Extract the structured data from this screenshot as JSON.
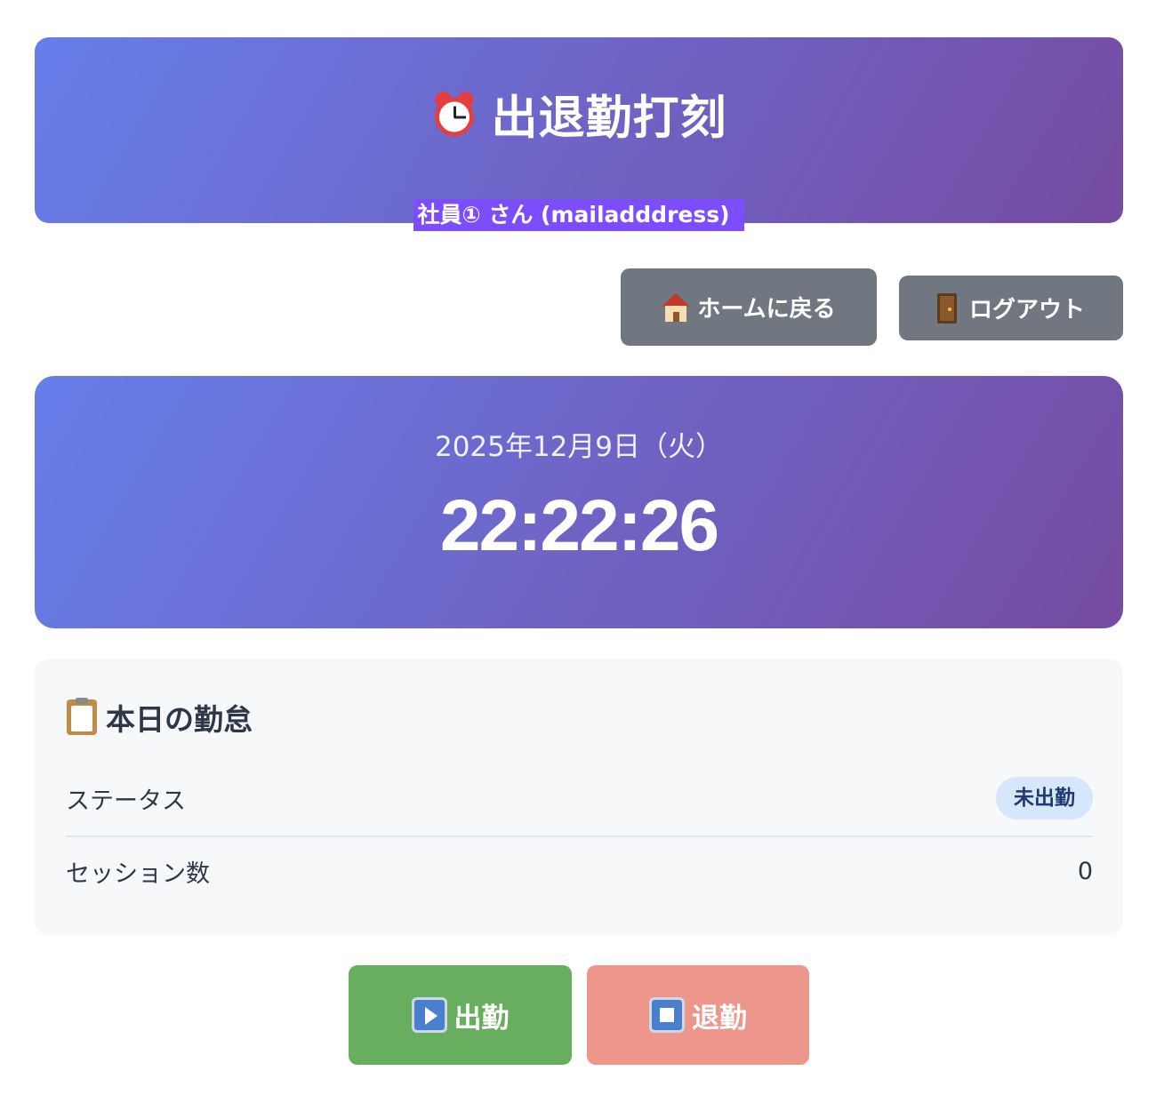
{
  "header": {
    "title": "出退勤打刻",
    "title_icon": "alarm-clock-icon",
    "user": "社員① さん (mailadddress)"
  },
  "nav": {
    "home_label": "ホームに戻る",
    "home_icon": "house-icon",
    "logout_label": "ログアウト",
    "logout_icon": "door-icon"
  },
  "clock": {
    "date": "2025年12月9日（火）",
    "time": "22:22:26"
  },
  "summary": {
    "title": "本日の勤怠",
    "title_icon": "clipboard-icon",
    "status_label": "ステータス",
    "status_value": "未出勤",
    "sessions_label": "セッション数",
    "sessions_value": "0"
  },
  "actions": {
    "clock_in_label": "出勤",
    "clock_in_icon": "play-icon",
    "clock_out_label": "退勤",
    "clock_out_icon": "stop-icon"
  },
  "colors": {
    "gradient_start": "#667eea",
    "gradient_end": "#764ba2",
    "clock_in": "#68ae5f",
    "clock_out": "#ed968b",
    "nav_button": "#717780",
    "status_badge_bg": "#d6e6fb"
  }
}
